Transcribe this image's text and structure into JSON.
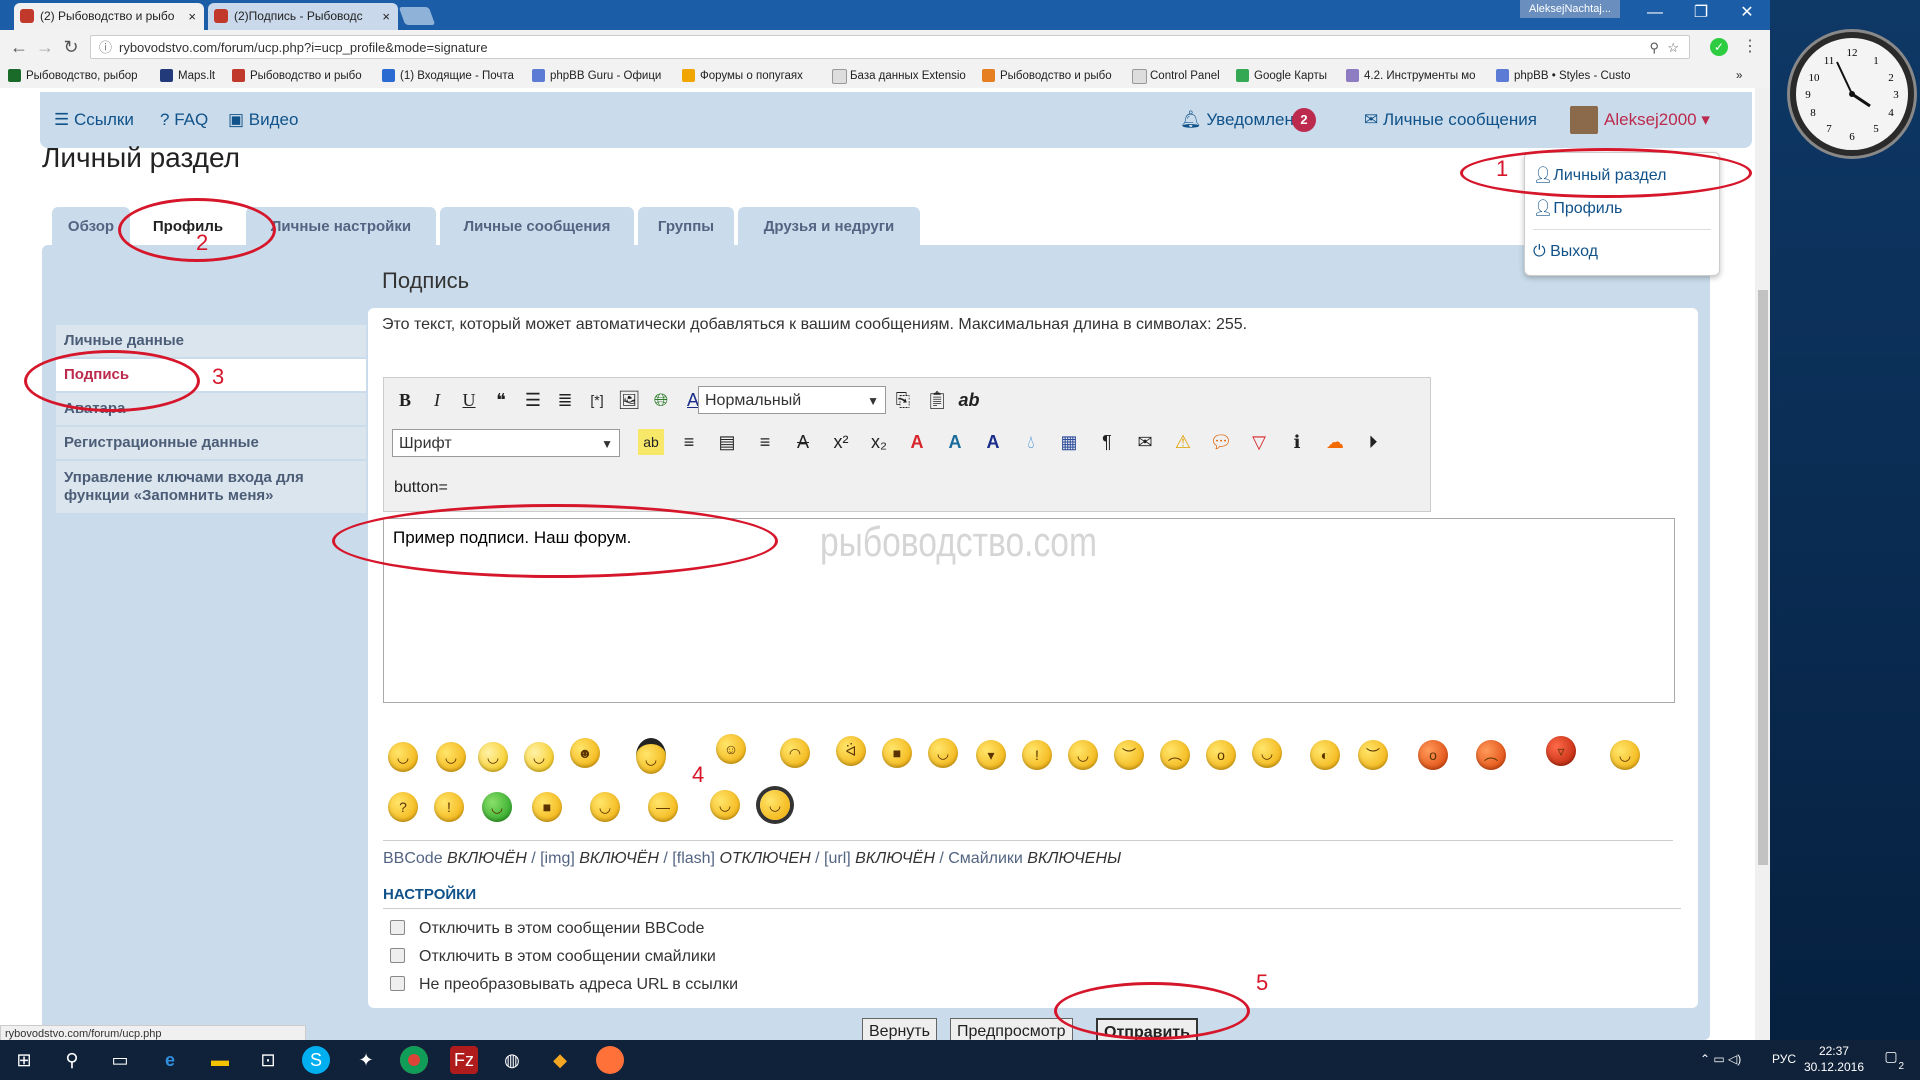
{
  "browser": {
    "tabs": [
      {
        "label": "(2) Рыбоводство и рыбо",
        "close": "×"
      },
      {
        "label": "(2)Подпись - Рыбоводс",
        "close": "×"
      }
    ],
    "user_tag": "AleksejNachtaj...",
    "win_buttons": [
      "—",
      "❐",
      "✕"
    ],
    "url": "rybovodstvo.com/forum/ucp.php?i=ucp_profile&mode=signature",
    "nav": {
      "back": "←",
      "forward": "→",
      "reload": "↻"
    },
    "bookmarks": [
      "Рыбоводство, рыбор",
      "Maps.lt",
      "Рыбоводство и рыбо",
      "(1) Входящие - Почта",
      "phpBB Guru - Офици",
      "Форумы о попугаях",
      "База данных Extensio",
      "Рыбоводство и рыбо",
      "Control Panel",
      "Google Карты",
      "4.2. Инструменты мо",
      "phpBB • Styles - Custo"
    ],
    "bookmark_more": "»",
    "status_url": "rybovodstvo.com/forum/ucp.php"
  },
  "forum": {
    "nav_links": [
      "Ссылки",
      "FAQ",
      "Видео"
    ],
    "notifications_label": "Уведомления",
    "notifications_count": "2",
    "messages_label": "Личные сообщения",
    "username": "Aleksej2000",
    "page_title": "Личный раздел",
    "tabs": [
      "Обзор",
      "Профиль",
      "Личные настройки",
      "Личные сообщения",
      "Группы",
      "Друзья и недруги"
    ],
    "side_menu": [
      "Личные данные",
      "Подпись",
      "Аватара",
      "Регистрационные данные",
      "Управление ключами входа для функции «Запомнить меня»"
    ],
    "section_title": "Подпись",
    "description": "Это текст, который может автоматически добавляться к вашим сообщениям. Максимальная длина в символах: 255.",
    "font_size_select": "Нормальный",
    "font_select": "Шрифт",
    "button_row_text": "button=",
    "signature_text": "Пример подписи. Наш форум.",
    "watermark": "рыбоводство.com",
    "bbcode_status": {
      "bbcode": "BBCode",
      "bbcode_state": "ВКЛЮЧЁН",
      "img": "[img]",
      "img_state": "ВКЛЮЧЁН",
      "flash": "[flash]",
      "flash_state": "ОТКЛЮЧЕН",
      "url": "[url]",
      "url_state": "ВКЛЮЧЁН",
      "smilies": "Смайлики",
      "smilies_state": "ВКЛЮЧЕНЫ"
    },
    "settings_title": "НАСТРОЙКИ",
    "options": [
      "Отключить в этом сообщении BBCode",
      "Отключить в этом сообщении смайлики",
      "Не преобразовывать адреса URL в ссылки"
    ],
    "buttons": {
      "reset": "Вернуть",
      "preview": "Предпросмотр",
      "submit": "Отправить"
    },
    "dropdown": [
      "Личный раздел",
      "Профиль",
      "Выход"
    ]
  },
  "annotations": [
    "1",
    "2",
    "3",
    "4",
    "5"
  ],
  "taskbar": {
    "lang": "РУС",
    "time": "22:37",
    "date": "30.12.2016",
    "notify_count": "2"
  },
  "clock": {
    "numbers": [
      "12",
      "1",
      "2",
      "3",
      "4",
      "5",
      "6",
      "7",
      "8",
      "9",
      "10",
      "11"
    ]
  }
}
